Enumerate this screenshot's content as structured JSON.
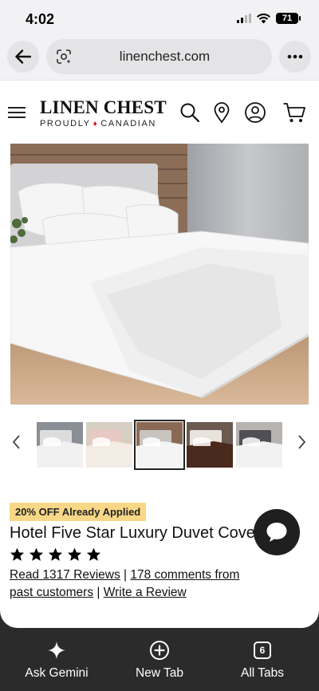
{
  "status": {
    "time": "4:02",
    "battery": "71"
  },
  "browser": {
    "url": "linenchest.com"
  },
  "site": {
    "logo_main": "LINEN CHEST",
    "logo_sub_left": "PROUDLY",
    "logo_sub_right": "CANADIAN"
  },
  "product": {
    "badge": "20% OFF Already Applied",
    "title": "Hotel Five Star Luxury Duvet Cover",
    "rating": 5,
    "reviews_link": "Read 1317 Reviews",
    "separator": "|",
    "comments_link": "178 comments from past customers",
    "write_review_link": "Write a Review",
    "thumbnails": [
      {
        "name": "white-bedding",
        "colors": [
          "#8a8f96",
          "#f1f1f1",
          "#dcdcdc"
        ]
      },
      {
        "name": "cream-bedding",
        "colors": [
          "#d7cfc4",
          "#f3ece4",
          "#e8c9c2"
        ]
      },
      {
        "name": "white-hotel-bedding",
        "colors": [
          "#8a6a55",
          "#f4f4f4",
          "#c9c4c0"
        ]
      },
      {
        "name": "brown-bedding",
        "colors": [
          "#6b5a50",
          "#4a2a1c",
          "#e9e3dd"
        ]
      },
      {
        "name": "grey-bedding",
        "colors": [
          "#b7b3b0",
          "#f2f2f2",
          "#4f4f55"
        ]
      }
    ]
  },
  "toolbar": {
    "gemini_label": "Ask Gemini",
    "newtab_label": "New Tab",
    "tabs_label": "All Tabs",
    "tab_count": "6"
  },
  "colors": {
    "badge": "#f8d887",
    "toolbar": "#2b2b2b",
    "maple": "#d21c1c"
  }
}
